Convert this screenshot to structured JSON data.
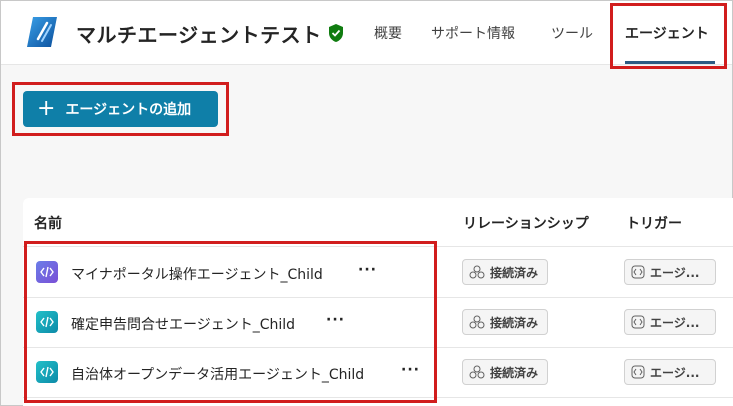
{
  "header": {
    "title": "マルチエージェントテスト",
    "tabs": [
      {
        "label": "概要"
      },
      {
        "label": "サポート情報"
      },
      {
        "label": "ツール"
      },
      {
        "label": "エージェント"
      }
    ]
  },
  "actions": {
    "add_agent_label": "エージェントの追加"
  },
  "table": {
    "columns": [
      "名前",
      "リレーションシップ",
      "トリガー"
    ],
    "rows": [
      {
        "name": "マイナポータル操作エージェント_Child",
        "relationship": "接続済み",
        "trigger": "エージ..."
      },
      {
        "name": "確定申告問合せエージェント_Child",
        "relationship": "接続済み",
        "trigger": "エージ..."
      },
      {
        "name": "自治体オープンデータ活用エージェント_Child",
        "relationship": "接続済み",
        "trigger": "エージ..."
      }
    ],
    "more_label": "···"
  },
  "colors": {
    "accent": "#0f7fa8",
    "highlight": "#d11d1d",
    "verified": "#107c10"
  }
}
